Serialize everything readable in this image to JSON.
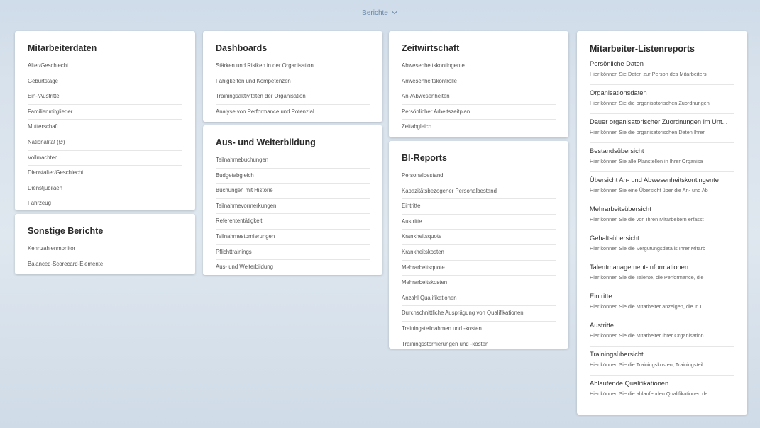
{
  "header": {
    "title": "Berichte"
  },
  "cards": {
    "mitarbeiterdaten": {
      "title": "Mitarbeiterdaten",
      "items": [
        "Alter/Geschlecht",
        "Geburtstage",
        "Ein-/Austritte",
        "Familienmitglieder",
        "Mutterschaft",
        "Nationalität (Ø)",
        "Vollmachten",
        "Dienstalter/Geschlecht",
        "Dienstjubiläen",
        "Fahrzeug"
      ]
    },
    "sonstige": {
      "title": "Sonstige Berichte",
      "items": [
        "Kennzahlenmonitor",
        "Balanced-Scorecard-Elemente"
      ]
    },
    "dashboards": {
      "title": "Dashboards",
      "items": [
        "Stärken und Risiken in der Organisation",
        "Fähigkeiten und Kompetenzen",
        "Trainingsaktivitäten der Organisation",
        "Analyse von Performance und Potenzial"
      ]
    },
    "weiterbildung": {
      "title": "Aus- und Weiterbildung",
      "items": [
        "Teilnahmebuchungen",
        "Budgetabgleich",
        "Buchungen mit Historie",
        "Teilnahmevormerkungen",
        "Referententätigkeit",
        "Teilnahmestornierungen",
        "Pflichttrainings",
        "Aus- und Weiterbildung"
      ]
    },
    "zeitwirtschaft": {
      "title": "Zeitwirtschaft",
      "items": [
        "Abwesenheitskontingente",
        "Anwesenheitskontrolle",
        "An-/Abwesenheiten",
        "Persönlicher Arbeitszeitplan",
        "Zeitabgleich"
      ]
    },
    "bireports": {
      "title": "BI-Reports",
      "items": [
        "Personalbestand",
        "Kapazitätsbezogener Personalbestand",
        "Eintritte",
        "Austritte",
        "Krankheitsquote",
        "Krankheitskosten",
        "Mehrarbeitsquote",
        "Mehrarbeitskosten",
        "Anzahl Qualifikationen",
        "Durchschnittliche Ausprägung von Qualifikationen",
        "Trainingsteilnahmen und -kosten",
        "Trainingsstornierungen und -kosten"
      ]
    },
    "listenreports": {
      "title": "Mitarbeiter-Listenreports",
      "items": [
        {
          "title": "Persönliche Daten",
          "desc": "Hier können Sie Daten zur Person des Mitarbeiters"
        },
        {
          "title": "Organisationsdaten",
          "desc": "Hier können Sie die organisatorischen Zuordnungen"
        },
        {
          "title": "Dauer organisatorischer Zuordnungen im Unt...",
          "desc": "Hier können Sie die organisatorischen Daten Ihrer"
        },
        {
          "title": "Bestandsübersicht",
          "desc": "Hier können Sie alle Planstellen in Ihrer Organisa"
        },
        {
          "title": "Übersicht An- und Abwesenheitskontingente",
          "desc": "Hier können Sie eine Übersicht über die An- und Ab"
        },
        {
          "title": "Mehrarbeitsübersicht",
          "desc": "Hier können Sie die von Ihren Mitarbeitern erfasst"
        },
        {
          "title": "Gehaltsübersicht",
          "desc": "Hier können Sie die Vergütungsdetails Ihrer Mitarb"
        },
        {
          "title": "Talentmanagement-Informationen",
          "desc": "Hier können Sie die Talente, die Performance, die"
        },
        {
          "title": "Eintritte",
          "desc": "Hier können Sie die Mitarbeiter anzeigen, die in I"
        },
        {
          "title": "Austritte",
          "desc": "Hier können Sie die Mitarbeiter Ihrer Organisation"
        },
        {
          "title": "Trainingsübersicht",
          "desc": "Hier können Sie die Trainingskosten, Trainingsteil"
        },
        {
          "title": "Ablaufende Qualifikationen",
          "desc": "Hier können Sie die ablaufenden Qualifikationen de"
        }
      ]
    }
  }
}
